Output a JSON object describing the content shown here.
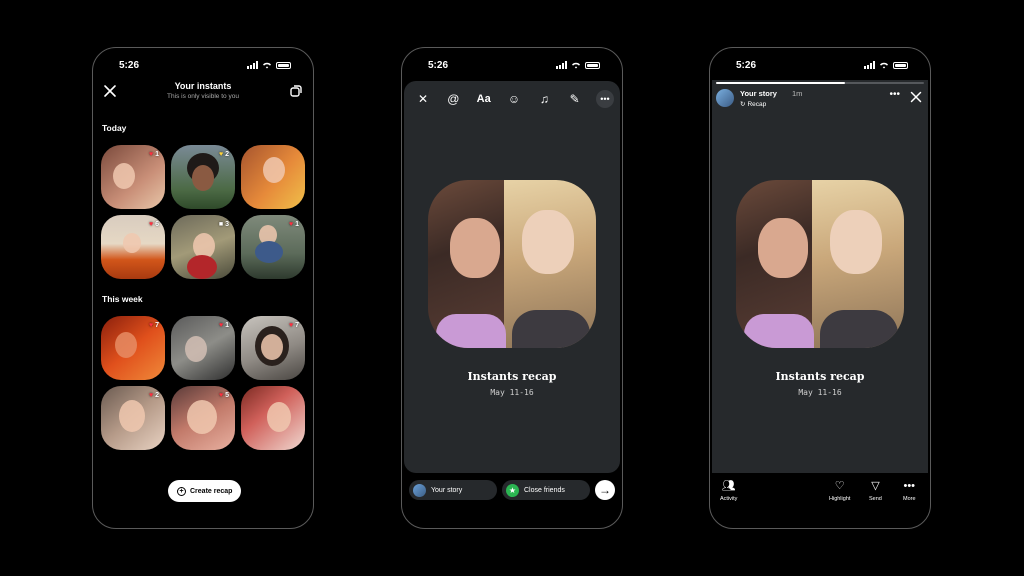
{
  "status_time": "5:26",
  "screen1": {
    "title": "Your instants",
    "subtitle": "This is only visible to you",
    "sections": [
      {
        "label": "Today",
        "tiles": [
          {
            "icon": "heart-icon",
            "glyph": "♥",
            "color": "#ff3040",
            "count": "1"
          },
          {
            "icon": "heart-icon",
            "glyph": "♥",
            "color": "#ffd43b",
            "count": "2"
          },
          {
            "icon": "heart-icon",
            "glyph": "",
            "color": "#ff3040",
            "count": ""
          },
          {
            "icon": "heart-icon",
            "glyph": "♥",
            "color": "#ff3040",
            "count": "6"
          },
          {
            "icon": "comment-icon",
            "glyph": "■",
            "color": "#ffffff",
            "count": "3"
          },
          {
            "icon": "heart-icon",
            "glyph": "♥",
            "color": "#ff3040",
            "count": "1"
          }
        ]
      },
      {
        "label": "This week",
        "tiles": [
          {
            "icon": "heart-icon",
            "glyph": "♥",
            "color": "#ff3040",
            "count": "7"
          },
          {
            "icon": "heart-icon",
            "glyph": "♥",
            "color": "#ff3040",
            "count": "1"
          },
          {
            "icon": "heart-icon",
            "glyph": "♥",
            "color": "#ff3040",
            "count": "7"
          },
          {
            "icon": "heart-icon",
            "glyph": "♥",
            "color": "#ff3040",
            "count": "2"
          },
          {
            "icon": "heart-icon",
            "glyph": "♥",
            "color": "#ff3040",
            "count": "5"
          },
          {
            "icon": "heart-icon",
            "glyph": "",
            "color": "#ff3040",
            "count": ""
          }
        ]
      }
    ],
    "create_label": "Create recap"
  },
  "recap": {
    "title": "Instants recap",
    "date": "May 11-16"
  },
  "screen2": {
    "your_story_label": "Your story",
    "close_friends_label": "Close friends"
  },
  "screen3": {
    "username": "Your story",
    "time_ago": "1m",
    "recap_tag": "Recap",
    "progress": 0.62,
    "actions": {
      "activity": "Activity",
      "highlight": "Highlight",
      "send": "Send",
      "more": "More"
    }
  },
  "colors": {
    "accent_green": "#2bb552",
    "story_bg": "#26292c",
    "heart": "#ff3040"
  }
}
